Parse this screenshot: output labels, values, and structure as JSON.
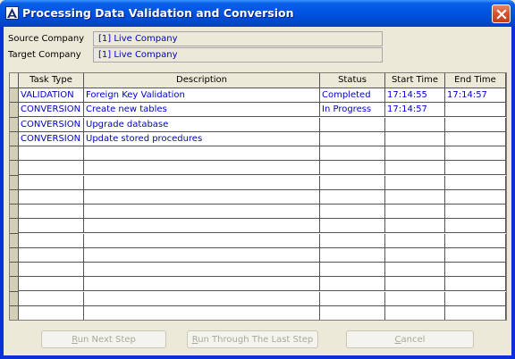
{
  "window": {
    "title": "Processing Data Validation and Conversion"
  },
  "fields": {
    "source_label": "Source Company",
    "source_value": "[1] Live Company",
    "target_label": "Target Company",
    "target_value": "[1] Live Company"
  },
  "table": {
    "columns": [
      "Task Type",
      "Description",
      "Status",
      "Start Time",
      "End Time"
    ],
    "rows": [
      [
        "VALIDATION",
        "Foreign Key Validation",
        "Completed",
        "17:14:55",
        "17:14:57"
      ],
      [
        "CONVERSION",
        "Create new tables",
        "In Progress",
        "17:14:57",
        ""
      ],
      [
        "CONVERSION",
        "Upgrade database",
        "",
        "",
        ""
      ],
      [
        "CONVERSION",
        "Update stored procedures",
        "",
        "",
        ""
      ]
    ],
    "empty_row_count": 12
  },
  "buttons": {
    "run_next_mnemonic": "R",
    "run_next_rest": "un Next Step",
    "run_last_mnemonic": "R",
    "run_last_rest": "un Through The Last Step",
    "cancel_mnemonic": "C",
    "cancel_rest": "ancel"
  },
  "colors": {
    "titlebar": "#0054e3",
    "cell_text": "#0000c8",
    "disabled_text": "#aca899",
    "face": "#ece9d8"
  },
  "icons": {
    "app": "app-logo-icon",
    "close": "close-icon"
  }
}
